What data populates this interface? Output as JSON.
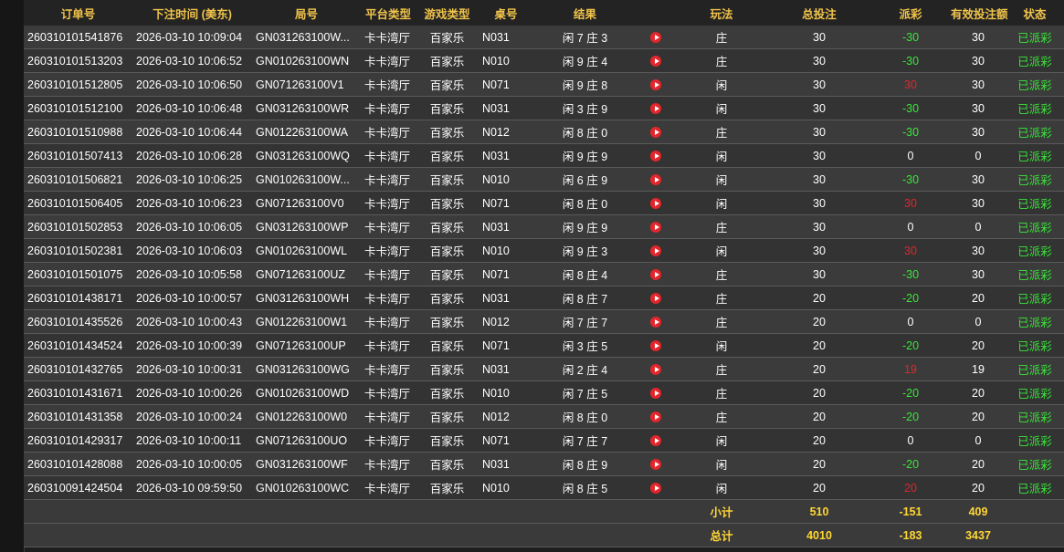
{
  "headers": {
    "order_no": "订单号",
    "bet_time": "下注时间 (美东)",
    "round_no": "局号",
    "platform": "平台类型",
    "game_type": "游戏类型",
    "table_no": "桌号",
    "result": "结果",
    "play": "玩法",
    "total_bet": "总投注",
    "payout": "派彩",
    "valid_bet": "有效投注额",
    "status": "状态"
  },
  "rows": [
    {
      "order": "260310101541876",
      "time": "2026-03-10 10:09:04",
      "round": "GN031263100W...",
      "platform": "卡卡湾厅",
      "game": "百家乐",
      "table": "N031",
      "result": "闲 7 庄 3",
      "play": "庄",
      "total": "30",
      "payout": "-30",
      "valid": "30",
      "status": "已派彩"
    },
    {
      "order": "260310101513203",
      "time": "2026-03-10 10:06:52",
      "round": "GN010263100WN",
      "platform": "卡卡湾厅",
      "game": "百家乐",
      "table": "N010",
      "result": "闲 9 庄 4",
      "play": "庄",
      "total": "30",
      "payout": "-30",
      "valid": "30",
      "status": "已派彩"
    },
    {
      "order": "260310101512805",
      "time": "2026-03-10 10:06:50",
      "round": "GN071263100V1",
      "platform": "卡卡湾厅",
      "game": "百家乐",
      "table": "N071",
      "result": "闲 9 庄 8",
      "play": "闲",
      "total": "30",
      "payout": "30",
      "valid": "30",
      "status": "已派彩"
    },
    {
      "order": "260310101512100",
      "time": "2026-03-10 10:06:48",
      "round": "GN031263100WR",
      "platform": "卡卡湾厅",
      "game": "百家乐",
      "table": "N031",
      "result": "闲 3 庄 9",
      "play": "闲",
      "total": "30",
      "payout": "-30",
      "valid": "30",
      "status": "已派彩"
    },
    {
      "order": "260310101510988",
      "time": "2026-03-10 10:06:44",
      "round": "GN012263100WA",
      "platform": "卡卡湾厅",
      "game": "百家乐",
      "table": "N012",
      "result": "闲 8 庄 0",
      "play": "庄",
      "total": "30",
      "payout": "-30",
      "valid": "30",
      "status": "已派彩"
    },
    {
      "order": "260310101507413",
      "time": "2026-03-10 10:06:28",
      "round": "GN031263100WQ",
      "platform": "卡卡湾厅",
      "game": "百家乐",
      "table": "N031",
      "result": "闲 9 庄 9",
      "play": "闲",
      "total": "30",
      "payout": "0",
      "valid": "0",
      "status": "已派彩"
    },
    {
      "order": "260310101506821",
      "time": "2026-03-10 10:06:25",
      "round": "GN010263100W...",
      "platform": "卡卡湾厅",
      "game": "百家乐",
      "table": "N010",
      "result": "闲 6 庄 9",
      "play": "闲",
      "total": "30",
      "payout": "-30",
      "valid": "30",
      "status": "已派彩"
    },
    {
      "order": "260310101506405",
      "time": "2026-03-10 10:06:23",
      "round": "GN071263100V0",
      "platform": "卡卡湾厅",
      "game": "百家乐",
      "table": "N071",
      "result": "闲 8 庄 0",
      "play": "闲",
      "total": "30",
      "payout": "30",
      "valid": "30",
      "status": "已派彩"
    },
    {
      "order": "260310101502853",
      "time": "2026-03-10 10:06:05",
      "round": "GN031263100WP",
      "platform": "卡卡湾厅",
      "game": "百家乐",
      "table": "N031",
      "result": "闲 9 庄 9",
      "play": "庄",
      "total": "30",
      "payout": "0",
      "valid": "0",
      "status": "已派彩"
    },
    {
      "order": "260310101502381",
      "time": "2026-03-10 10:06:03",
      "round": "GN010263100WL",
      "platform": "卡卡湾厅",
      "game": "百家乐",
      "table": "N010",
      "result": "闲 9 庄 3",
      "play": "闲",
      "total": "30",
      "payout": "30",
      "valid": "30",
      "status": "已派彩"
    },
    {
      "order": "260310101501075",
      "time": "2026-03-10 10:05:58",
      "round": "GN071263100UZ",
      "platform": "卡卡湾厅",
      "game": "百家乐",
      "table": "N071",
      "result": "闲 8 庄 4",
      "play": "庄",
      "total": "30",
      "payout": "-30",
      "valid": "30",
      "status": "已派彩"
    },
    {
      "order": "260310101438171",
      "time": "2026-03-10 10:00:57",
      "round": "GN031263100WH",
      "platform": "卡卡湾厅",
      "game": "百家乐",
      "table": "N031",
      "result": "闲 8 庄 7",
      "play": "庄",
      "total": "20",
      "payout": "-20",
      "valid": "20",
      "status": "已派彩"
    },
    {
      "order": "260310101435526",
      "time": "2026-03-10 10:00:43",
      "round": "GN012263100W1",
      "platform": "卡卡湾厅",
      "game": "百家乐",
      "table": "N012",
      "result": "闲 7 庄 7",
      "play": "庄",
      "total": "20",
      "payout": "0",
      "valid": "0",
      "status": "已派彩"
    },
    {
      "order": "260310101434524",
      "time": "2026-03-10 10:00:39",
      "round": "GN071263100UP",
      "platform": "卡卡湾厅",
      "game": "百家乐",
      "table": "N071",
      "result": "闲 3 庄 5",
      "play": "闲",
      "total": "20",
      "payout": "-20",
      "valid": "20",
      "status": "已派彩"
    },
    {
      "order": "260310101432765",
      "time": "2026-03-10 10:00:31",
      "round": "GN031263100WG",
      "platform": "卡卡湾厅",
      "game": "百家乐",
      "table": "N031",
      "result": "闲 2 庄 4",
      "play": "庄",
      "total": "20",
      "payout": "19",
      "valid": "19",
      "status": "已派彩"
    },
    {
      "order": "260310101431671",
      "time": "2026-03-10 10:00:26",
      "round": "GN010263100WD",
      "platform": "卡卡湾厅",
      "game": "百家乐",
      "table": "N010",
      "result": "闲 7 庄 5",
      "play": "庄",
      "total": "20",
      "payout": "-20",
      "valid": "20",
      "status": "已派彩"
    },
    {
      "order": "260310101431358",
      "time": "2026-03-10 10:00:24",
      "round": "GN012263100W0",
      "platform": "卡卡湾厅",
      "game": "百家乐",
      "table": "N012",
      "result": "闲 8 庄 0",
      "play": "庄",
      "total": "20",
      "payout": "-20",
      "valid": "20",
      "status": "已派彩"
    },
    {
      "order": "260310101429317",
      "time": "2026-03-10 10:00:11",
      "round": "GN071263100UO",
      "platform": "卡卡湾厅",
      "game": "百家乐",
      "table": "N071",
      "result": "闲 7 庄 7",
      "play": "闲",
      "total": "20",
      "payout": "0",
      "valid": "0",
      "status": "已派彩"
    },
    {
      "order": "260310101428088",
      "time": "2026-03-10 10:00:05",
      "round": "GN031263100WF",
      "platform": "卡卡湾厅",
      "game": "百家乐",
      "table": "N031",
      "result": "闲 8 庄 9",
      "play": "闲",
      "total": "20",
      "payout": "-20",
      "valid": "20",
      "status": "已派彩"
    },
    {
      "order": "260310091424504",
      "time": "2026-03-10 09:59:50",
      "round": "GN010263100WC",
      "platform": "卡卡湾厅",
      "game": "百家乐",
      "table": "N010",
      "result": "闲 8 庄 5",
      "play": "闲",
      "total": "20",
      "payout": "20",
      "valid": "20",
      "status": "已派彩"
    }
  ],
  "subtotal": {
    "label": "小计",
    "total": "510",
    "payout": "-151",
    "valid": "409"
  },
  "grand_total": {
    "label": "总计",
    "total": "4010",
    "payout": "-183",
    "valid": "3437"
  },
  "colors": {
    "header_text": "#f0c34a",
    "payout_negative": "#39e639",
    "payout_positive": "#e0262b",
    "status": "#39e639",
    "summary_text": "#ffd633",
    "video_icon": "#e3262b"
  },
  "icons": {
    "video": "play-video-icon"
  }
}
